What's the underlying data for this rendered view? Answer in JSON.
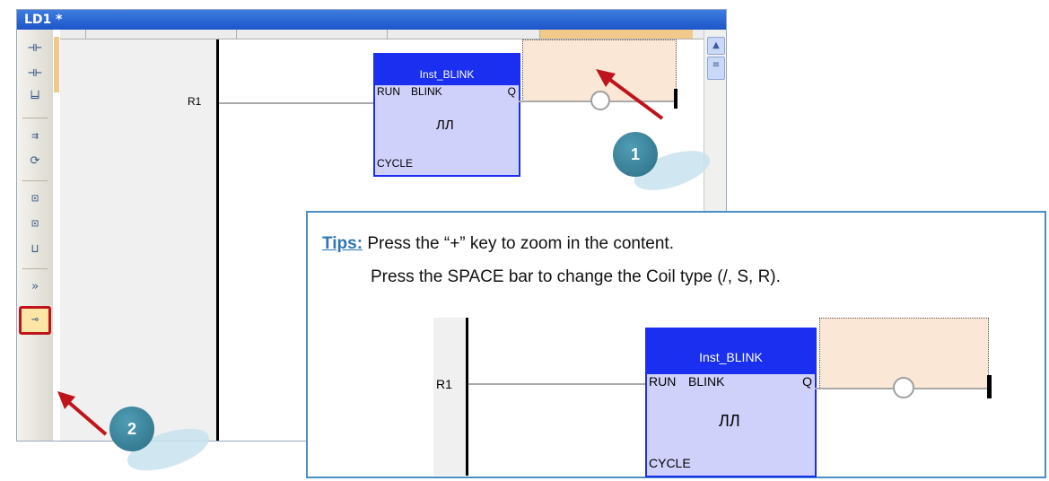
{
  "window": {
    "title": "LD1 *"
  },
  "toolbar": {
    "items": [
      {
        "name": "contact-before-icon",
        "glyph": "⊣⊢"
      },
      {
        "name": "contact-after-icon",
        "glyph": "⊣⊢"
      },
      {
        "name": "parallel-contact-icon",
        "glyph": "╘╛"
      },
      {
        "name": "jump-icon",
        "glyph": "⇉"
      },
      {
        "name": "return-icon",
        "glyph": "⟳"
      },
      {
        "name": "block-before-icon",
        "glyph": "⊡"
      },
      {
        "name": "block-after-icon",
        "glyph": "⊡"
      },
      {
        "name": "parallel-block-icon",
        "glyph": "⊔"
      },
      {
        "name": "arrow-icon",
        "glyph": "»"
      },
      {
        "name": "coil-icon",
        "glyph": "⊸"
      }
    ]
  },
  "diagram": {
    "contact_label": "R1",
    "block": {
      "instance": "Inst_BLINK",
      "type": "BLINK",
      "input_run": "RUN",
      "output_q": "Q",
      "input_cycle": "CYCLE",
      "symbol": "ЛЛ"
    }
  },
  "callouts": {
    "one": "1",
    "two": "2"
  },
  "tips": {
    "label": "Tips:",
    "line1": "Press the “+” key to zoom in the content.",
    "line2": "Press the SPACE bar to change the Coil type (/, S, R)."
  },
  "zoomed": {
    "contact_label": "R1",
    "block": {
      "instance": "Inst_BLINK",
      "type": "BLINK",
      "input_run": "RUN",
      "output_q": "Q",
      "input_cycle": "CYCLE",
      "symbol": "ЛЛ"
    }
  },
  "colors": {
    "titlebar": "#1c55c8",
    "block_fill": "#d0d1fb",
    "block_border": "#1a2ff0",
    "coil_area": "#fbe7d6",
    "highlight": "#f2c98a",
    "callout": "#2c6d84",
    "arrow": "#c0141c",
    "tips_border": "#4a8fc3"
  }
}
